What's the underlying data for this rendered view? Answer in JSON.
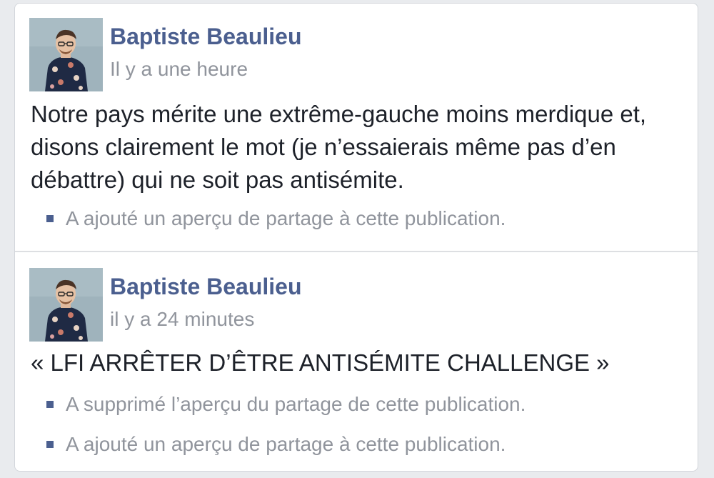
{
  "posts": [
    {
      "author": "Baptiste Beaulieu",
      "time": "Il y a une heure",
      "text": "Notre pays mérite une extrême-gauche moins merdique et, disons clairement le mot (je n’essaierais même pas d’en débattre) qui ne soit pas antisémite.",
      "edits": [
        "A ajouté un aperçu de partage à cette publication."
      ]
    },
    {
      "author": "Baptiste Beaulieu",
      "time": "il y a 24 minutes",
      "text": "« LFI ARRÊTER D’ÊTRE ANTISÉMITE CHALLENGE »",
      "edits": [
        "A supprimé l’aperçu du partage de cette publication.",
        "A ajouté un aperçu de partage à cette publication."
      ]
    }
  ],
  "colors": {
    "author_name": "#4b5f8f",
    "meta_text": "#90949c",
    "body_text": "#1d2129",
    "card_background": "#ffffff",
    "page_background": "#e9ebee"
  }
}
